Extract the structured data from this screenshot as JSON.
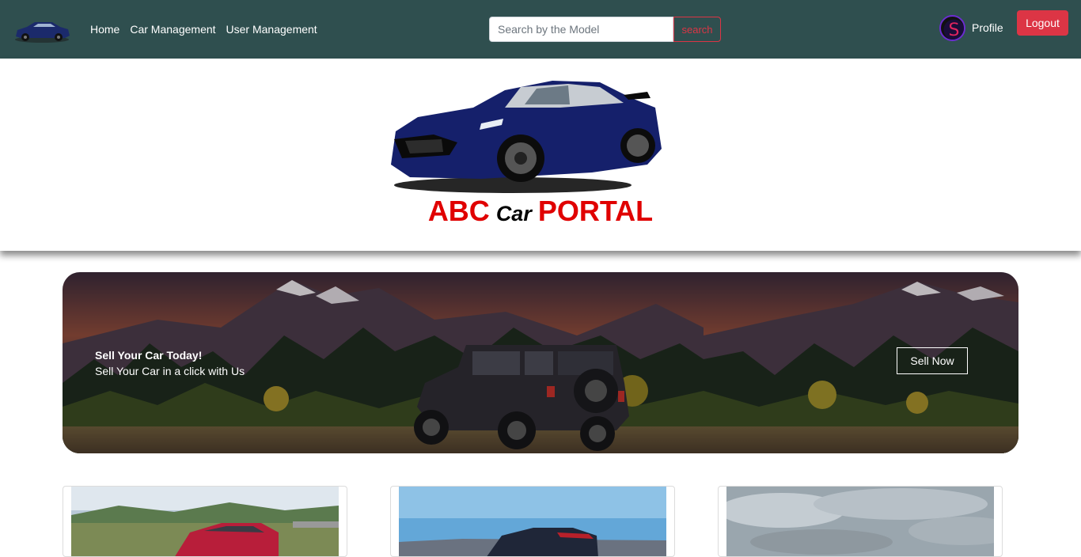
{
  "nav": {
    "links": [
      "Home",
      "Car Management",
      "User Management"
    ],
    "search_placeholder": "Search by the Model",
    "search_button": "search",
    "avatar_initial": "S",
    "profile_label": "Profile",
    "logout_label": "Logout"
  },
  "hero": {
    "title_left": "ABC",
    "title_mid": "Car",
    "title_right": "PORTAL"
  },
  "banner": {
    "heading": "Sell Your Car Today!",
    "subheading": "Sell Your Car in a click with Us",
    "button_label": "Sell Now"
  },
  "cards": [
    {
      "name": "red-sports-car"
    },
    {
      "name": "dark-sedan"
    },
    {
      "name": "cloudy-sky-car"
    }
  ],
  "colors": {
    "navbar": "#2f4f4f",
    "accent_red": "#dc3545",
    "title_red": "#e00000"
  }
}
